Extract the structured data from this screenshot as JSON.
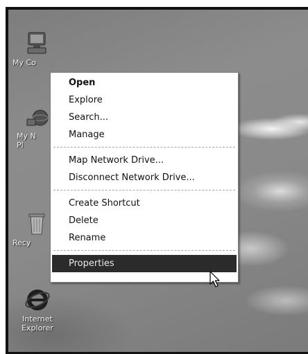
{
  "desktop_icons": [
    {
      "label": "My Co",
      "icon": "my-computer-icon"
    },
    {
      "label": "My N\nPl",
      "icon": "my-network-places-icon"
    },
    {
      "label": "Recy",
      "icon": "recycle-bin-icon"
    },
    {
      "label": "Internet\nExplorer",
      "icon": "internet-explorer-icon"
    }
  ],
  "context_menu": {
    "items": [
      {
        "label": "Open"
      },
      {
        "label": "Explore"
      },
      {
        "label": "Search..."
      },
      {
        "label": "Manage"
      },
      {
        "label": "Map Network Drive..."
      },
      {
        "label": "Disconnect Network Drive..."
      },
      {
        "label": "Create Shortcut"
      },
      {
        "label": "Delete"
      },
      {
        "label": "Rename"
      },
      {
        "label": "Properties"
      }
    ],
    "selected": "Properties"
  },
  "colors": {
    "menu_background": "#ffffff",
    "highlight": "#2b2b2b",
    "desktop": "#858585"
  }
}
